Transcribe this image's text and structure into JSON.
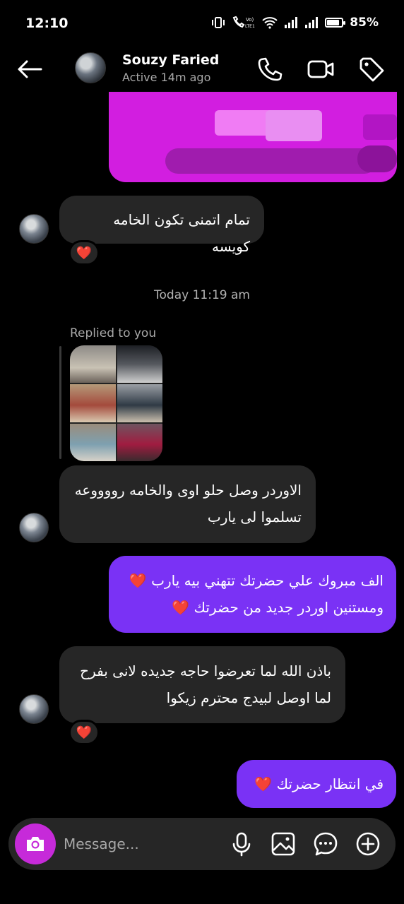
{
  "status_bar": {
    "time": "12:10",
    "battery": "85%",
    "indicators": [
      "vibrate-icon",
      "call-volte-icon",
      "wifi-icon",
      "signal-icon",
      "signal-icon",
      "battery-icon"
    ],
    "volte_text": "Vo)",
    "lte_text": "LTE1"
  },
  "header": {
    "name": "Souzy Faried",
    "status": "Active 14m ago",
    "icons": [
      "back-arrow-icon",
      "phone-icon",
      "video-camera-icon",
      "tag-icon"
    ]
  },
  "messages": [
    {
      "id": "m1",
      "direction": "in",
      "lines": [
        "تمام اتمنى تكون الخامه كويسه"
      ],
      "reaction": "❤️"
    },
    {
      "id": "m2",
      "direction": "in",
      "lines": [
        "الاوردر وصل حلو اوى والخامه رووووعه",
        "تسلموا لى يارب"
      ]
    },
    {
      "id": "m3",
      "direction": "out",
      "lines": [
        "الف مبروك علي حضرتك تتهني بيه يارب ❤️",
        "ومستنين اوردر جديد من حضرتك ❤️"
      ]
    },
    {
      "id": "m4",
      "direction": "in",
      "lines": [
        "باذن الله لما تعرضوا حاجه جديده لانى بفرح",
        "لما اوصل لبيدج محترم زيكوا"
      ],
      "reaction": "❤️"
    },
    {
      "id": "m5",
      "direction": "out",
      "lines": [
        "في انتظار حضرتك ❤️"
      ]
    }
  ],
  "timestamp": "Today 11:19 am",
  "reply": {
    "label": "Replied to you"
  },
  "composer": {
    "placeholder": "Message...",
    "icons": [
      "camera-icon",
      "microphone-icon",
      "image-icon",
      "sticker-icon",
      "plus-circle-icon"
    ]
  },
  "colors": {
    "background": "#000000",
    "incoming_bubble": "#262626",
    "outgoing_bubble": "#7a32f5",
    "camera_button": "#c62ad9",
    "heart": "#e0102d",
    "pink_message": "#d21ee0"
  }
}
